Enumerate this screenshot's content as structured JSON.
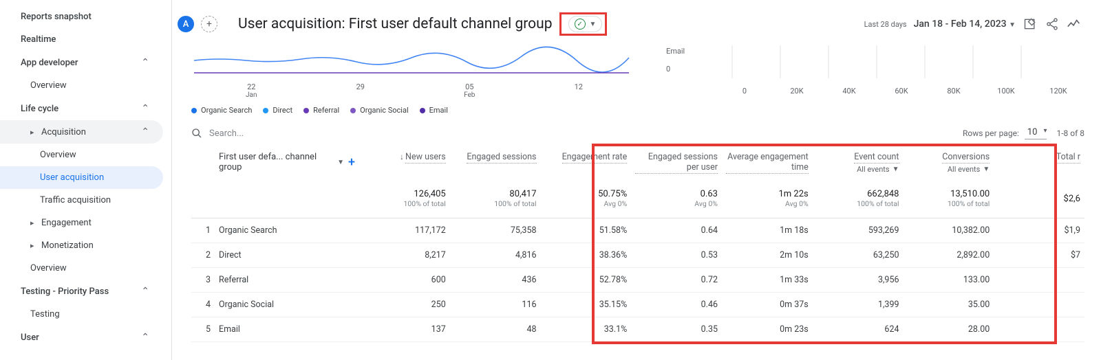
{
  "sidebar": {
    "items": [
      {
        "label": "Reports snapshot",
        "level": 1
      },
      {
        "label": "Realtime",
        "level": 1
      },
      {
        "label": "App developer",
        "level": 1,
        "chev": "up"
      },
      {
        "label": "Overview",
        "level": 2
      },
      {
        "label": "Life cycle",
        "level": 1,
        "chev": "up"
      },
      {
        "label": "Acquisition",
        "level": 2,
        "selectedParent": true,
        "caret": true,
        "chev": "up"
      },
      {
        "label": "Overview",
        "level": 3
      },
      {
        "label": "User acquisition",
        "level": 3,
        "active": true
      },
      {
        "label": "Traffic acquisition",
        "level": 3
      },
      {
        "label": "Engagement",
        "level": 2,
        "caret": true
      },
      {
        "label": "Monetization",
        "level": 2,
        "caret": true
      },
      {
        "label": "Overview",
        "level": 2
      },
      {
        "label": "Testing - Priority Pass",
        "level": 1,
        "chev": "up"
      },
      {
        "label": "Testing",
        "level": 2
      },
      {
        "label": "User",
        "level": 1,
        "chev": "up"
      }
    ]
  },
  "header": {
    "avatar": "A",
    "title": "User acquisition: First user default channel group",
    "date_period_label": "Last 28 days",
    "date_range": "Jan 18 - Feb 14, 2023"
  },
  "chart_data": [
    {
      "type": "line",
      "x_ticks": [
        {
          "d": "22",
          "m": "Jan"
        },
        {
          "d": "29",
          "m": ""
        },
        {
          "d": "05",
          "m": "Feb"
        },
        {
          "d": "12",
          "m": ""
        }
      ],
      "y_ticks": [
        "0"
      ],
      "series": [
        {
          "name": "Organic Search",
          "color": "#1a73e8"
        },
        {
          "name": "Direct",
          "color": "#1a73e8"
        },
        {
          "name": "Referral",
          "color": "#673ab7"
        },
        {
          "name": "Organic Social",
          "color": "#673ab7"
        },
        {
          "name": "Email",
          "color": "#673ab7"
        }
      ],
      "extra_label": "Email"
    },
    {
      "type": "bar_axis",
      "x_ticks": [
        "0",
        "20K",
        "40K",
        "60K",
        "80K",
        "100K",
        "120K"
      ]
    }
  ],
  "legend": [
    {
      "label": "Organic Search",
      "color": "#1a73e8"
    },
    {
      "label": "Direct",
      "color": "#2196f3"
    },
    {
      "label": "Referral",
      "color": "#673ab7"
    },
    {
      "label": "Organic Social",
      "color": "#7e57c2"
    },
    {
      "label": "Email",
      "color": "#512da8"
    }
  ],
  "toolbar": {
    "search_placeholder": "Search...",
    "rows_per_page_label": "Rows per page:",
    "rows_per_page_value": "10",
    "range_text": "1-8 of 8"
  },
  "table": {
    "dimension_header": "First user defa... channel group",
    "columns": [
      {
        "label": "New users",
        "sort": true
      },
      {
        "label": "Engaged sessions"
      },
      {
        "label": "Engagement rate"
      },
      {
        "label": "Engaged sessions per user"
      },
      {
        "label": "Average engagement time"
      },
      {
        "label": "Event count",
        "sub": "All events",
        "dd": true
      },
      {
        "label": "Conversions",
        "sub": "All events",
        "dd": true
      },
      {
        "label": "Total r"
      }
    ],
    "totals": [
      {
        "v": "126,405",
        "s": "100% of total"
      },
      {
        "v": "80,417",
        "s": "100% of total"
      },
      {
        "v": "50.75%",
        "s": "Avg 0%"
      },
      {
        "v": "0.63",
        "s": "Avg 0%"
      },
      {
        "v": "1m 22s",
        "s": "Avg 0%"
      },
      {
        "v": "662,848",
        "s": "100% of total"
      },
      {
        "v": "13,510.00",
        "s": "100% of total"
      },
      {
        "v": "$2,6",
        "s": ""
      }
    ],
    "rows": [
      {
        "idx": "1",
        "dim": "Organic Search",
        "cells": [
          "117,172",
          "75,358",
          "51.58%",
          "0.64",
          "1m 18s",
          "593,269",
          "10,382.00",
          "$1,9"
        ]
      },
      {
        "idx": "2",
        "dim": "Direct",
        "cells": [
          "8,217",
          "4,816",
          "38.36%",
          "0.53",
          "2m 10s",
          "63,250",
          "2,892.00",
          "$7"
        ]
      },
      {
        "idx": "3",
        "dim": "Referral",
        "cells": [
          "600",
          "436",
          "52.78%",
          "0.72",
          "1m 33s",
          "3,956",
          "133.00",
          ""
        ]
      },
      {
        "idx": "4",
        "dim": "Organic Social",
        "cells": [
          "250",
          "116",
          "35.15%",
          "0.46",
          "0m 37s",
          "1,399",
          "35.00",
          ""
        ]
      },
      {
        "idx": "5",
        "dim": "Email",
        "cells": [
          "137",
          "48",
          "33.1%",
          "0.35",
          "0m 23s",
          "624",
          "28.00",
          ""
        ]
      }
    ]
  }
}
